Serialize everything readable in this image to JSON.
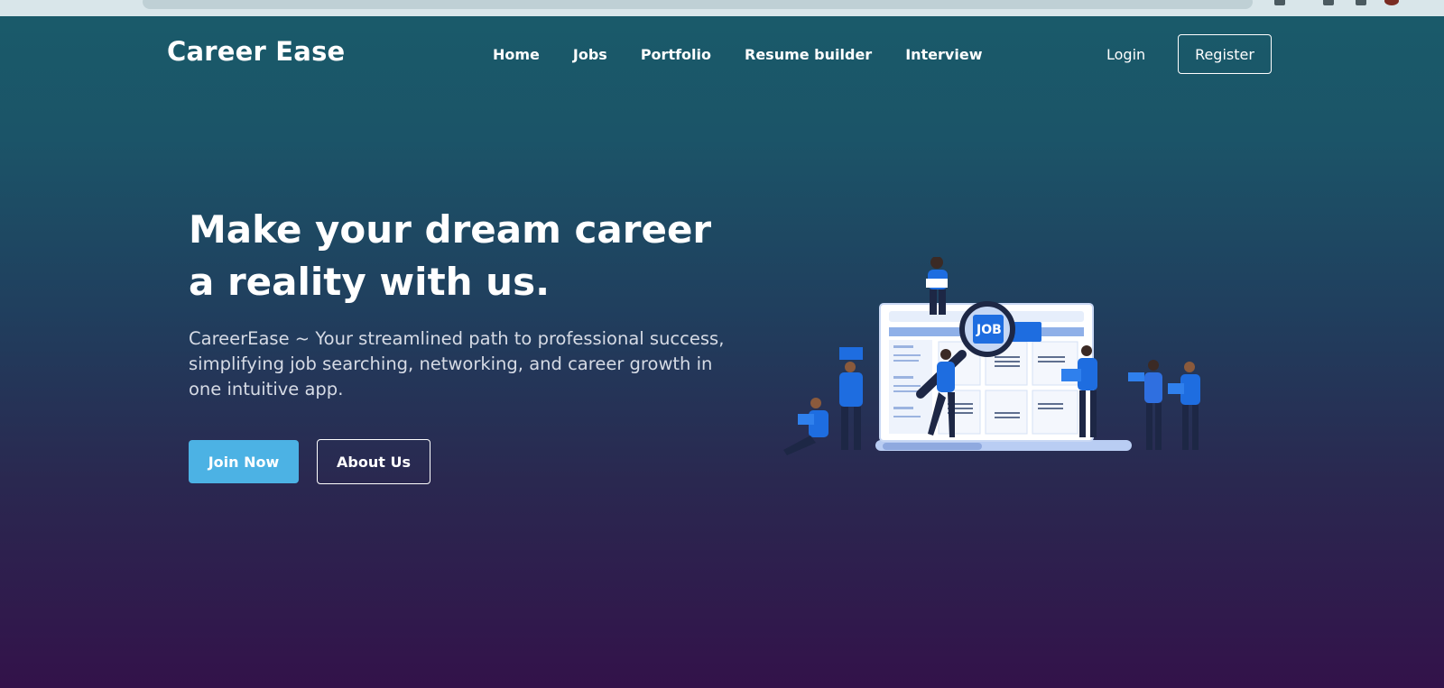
{
  "nav": {
    "brand": "Career Ease",
    "links": [
      "Home",
      "Jobs",
      "Portfolio",
      "Resume builder",
      "Interview"
    ],
    "login": "Login",
    "register": "Register"
  },
  "hero": {
    "title": "Make your dream career a reality with us.",
    "subtitle": "CareerEase ~ Your streamlined path to professional success, simplifying job searching, networking, and career growth in one intuitive app.",
    "join_button": "Join Now",
    "about_button": "About Us",
    "illustration_badge": "JOB"
  },
  "colors": {
    "accent": "#4cb2e4",
    "figure_blue": "#1e6de0",
    "background_top": "#1a5b6a",
    "background_bottom": "#33124a"
  }
}
